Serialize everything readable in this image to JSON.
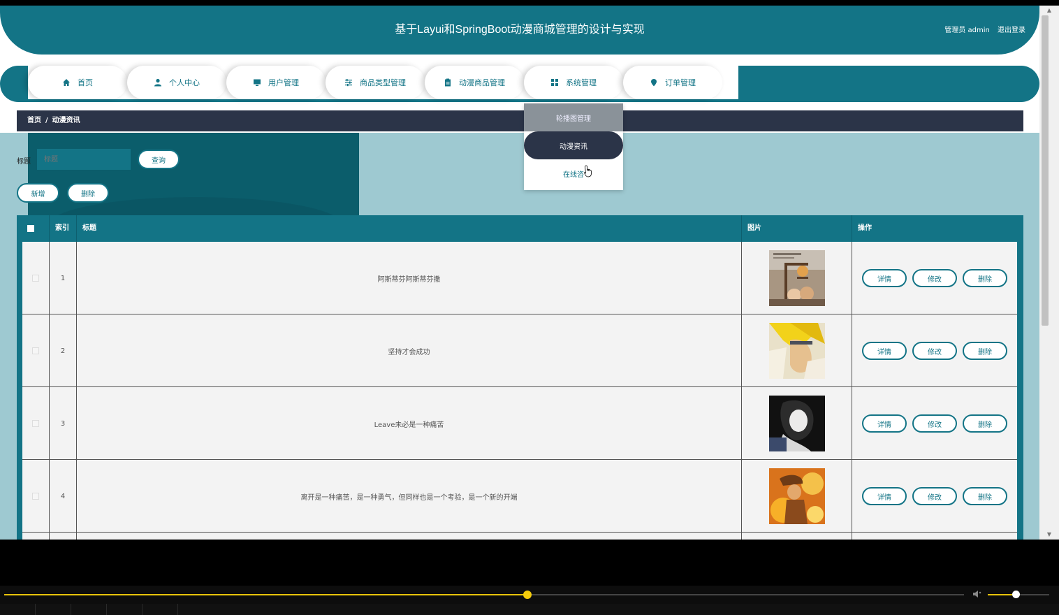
{
  "header": {
    "title": "基于Layui和SpringBoot动漫商城管理的设计与实现",
    "user_label": "管理员 admin",
    "logout_label": "退出登录"
  },
  "nav": [
    {
      "label": "首页",
      "icon": "home-icon"
    },
    {
      "label": "个人中心",
      "icon": "user-icon"
    },
    {
      "label": "用户管理",
      "icon": "monitor-icon"
    },
    {
      "label": "商品类型管理",
      "icon": "sliders-icon"
    },
    {
      "label": "动漫商品管理",
      "icon": "clipboard-icon"
    },
    {
      "label": "系统管理",
      "icon": "grid-icon"
    },
    {
      "label": "订单管理",
      "icon": "location-pin-icon"
    }
  ],
  "dropdown": {
    "items": [
      "轮播图管理",
      "动漫资讯",
      "在线咨"
    ],
    "active": "动漫资讯"
  },
  "breadcrumb": {
    "home": "首页",
    "separator": "/",
    "current": "动漫资讯"
  },
  "search": {
    "label": "标题",
    "placeholder": "标题",
    "query_button": "查询",
    "add_button": "新增",
    "delete_button": "删除"
  },
  "table": {
    "headers": {
      "index": "索引",
      "title": "标题",
      "image": "图片",
      "actions": "操作"
    },
    "rows": [
      {
        "index": "1",
        "title": "阿斯蒂芬阿斯蒂芬撒"
      },
      {
        "index": "2",
        "title": "坚持才会成功"
      },
      {
        "index": "3",
        "title": "Leave未必是一种痛苦"
      },
      {
        "index": "4",
        "title": "离开是一种痛苦，是一种勇气，但同样也是一个考验，是一个新的开端"
      }
    ],
    "row_actions": {
      "detail": "详情",
      "edit": "修改",
      "delete": "删除"
    }
  },
  "player": {
    "progress": 0.545,
    "volume": 0.45,
    "accent": "#f5cc0b"
  },
  "colors": {
    "primary": "#137486",
    "dark": "#2b3448",
    "background": "#9ec9d1"
  }
}
